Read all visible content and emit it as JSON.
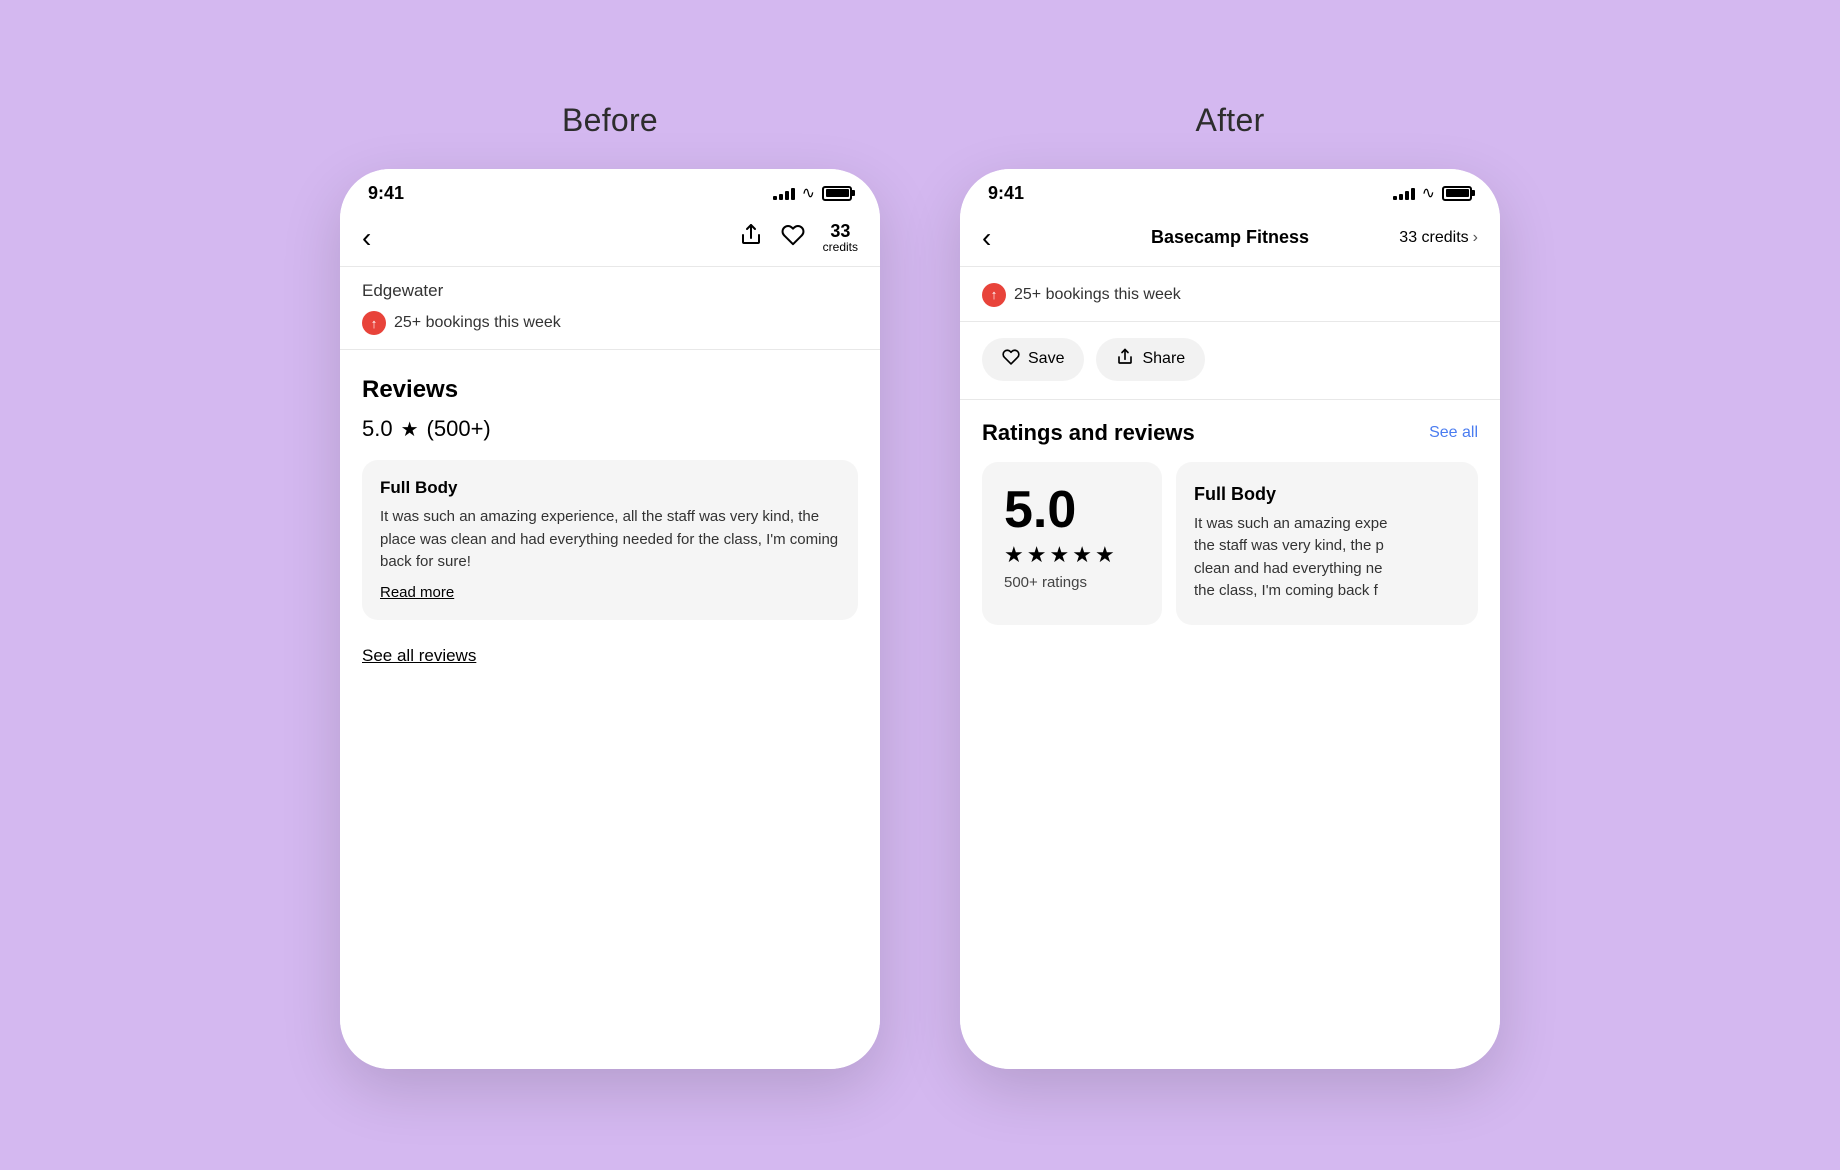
{
  "before": {
    "label": "Before",
    "status_bar": {
      "time": "9:41",
      "signal_bars": [
        4,
        6,
        8,
        10,
        12
      ],
      "wifi": "wifi",
      "battery_full": true
    },
    "nav": {
      "back_icon": "‹",
      "credits": "33",
      "credits_label": "credits"
    },
    "location": {
      "name": "Edgewater",
      "fire_emoji": "🔥",
      "bookings_text": "25+ bookings this week"
    },
    "reviews": {
      "title": "Reviews",
      "rating": "5.0",
      "star": "★",
      "count": "(500+)",
      "card": {
        "category": "Full Body",
        "text": "It was such an amazing experience, all the staff was very kind, the place was clean and had everything needed for the class, I'm coming back for sure!",
        "read_more": "Read more"
      },
      "see_all": "See all reviews"
    }
  },
  "after": {
    "label": "After",
    "status_bar": {
      "time": "9:41"
    },
    "nav": {
      "back_icon": "‹",
      "title": "Basecamp Fitness",
      "credits": "33 credits",
      "chevron": "›"
    },
    "bookings": {
      "fire_emoji": "🔥",
      "text": "25+ bookings this week"
    },
    "actions": {
      "save": "Save",
      "share": "Share"
    },
    "ratings": {
      "title": "Ratings and reviews",
      "see_all": "See all",
      "big_card": {
        "rating": "5.0",
        "stars": [
          "★",
          "★",
          "★",
          "★",
          "★"
        ],
        "count": "500+ ratings"
      },
      "review_card": {
        "category": "Full Body",
        "text": "It was such an amazing expe the staff was very kind, the p clean and had everything ne the class, I'm coming back f"
      }
    }
  }
}
